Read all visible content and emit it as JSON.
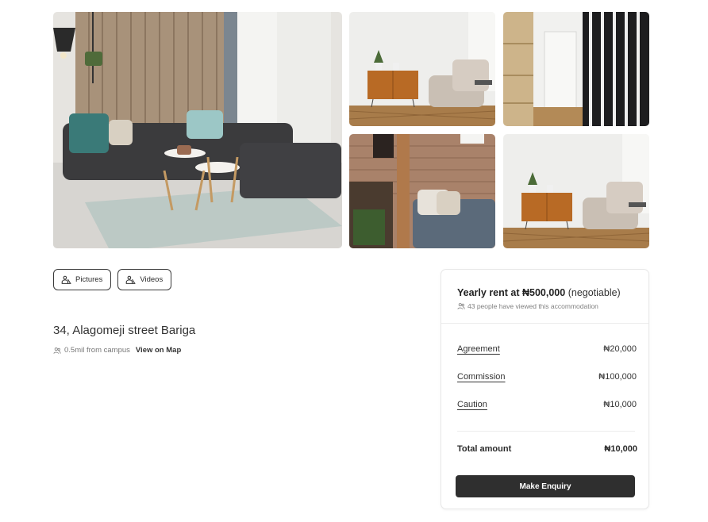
{
  "gallery": {
    "photos": [
      {
        "name": "living-room-sofa"
      },
      {
        "name": "cabinet-armchair"
      },
      {
        "name": "hallway-door"
      },
      {
        "name": "brick-wall-sofa"
      },
      {
        "name": "cabinet-armchair-2"
      }
    ]
  },
  "media": {
    "pictures_label": "Pictures",
    "videos_label": "Videos",
    "pictures_icon": "image-icon",
    "videos_icon": "image-icon"
  },
  "listing": {
    "address": "34, Alagomeji street Bariga",
    "distance": "0.5mil from campus",
    "map_link": "View on Map"
  },
  "pricing": {
    "rent_prefix": "Yearly rent at",
    "rent_amount": "₦500,000",
    "rent_note": "(negotiable)",
    "views_text": "43 people have viewed this accommodation",
    "fees": [
      {
        "label": "Agreement",
        "value": "₦20,000"
      },
      {
        "label": "Commission",
        "value": "₦100,000"
      },
      {
        "label": "Caution",
        "value": "₦10,000"
      }
    ],
    "total_label": "Total amount",
    "total_value": "₦10,000",
    "cta_label": "Make Enquiry"
  }
}
